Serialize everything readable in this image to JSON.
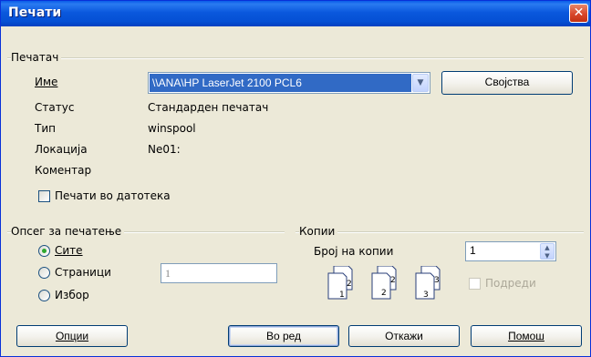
{
  "window": {
    "title": "Печати",
    "close": "✕"
  },
  "printer": {
    "group_title": "Печатач",
    "name_label": "Име",
    "name_value": "\\\\ANA\\HP LaserJet 2100 PCL6",
    "properties_button": "Својства",
    "status_label": "Статус",
    "status_value": "Стандарден печатач",
    "type_label": "Тип",
    "type_value": "winspool",
    "location_label": "Локација",
    "location_value": "Ne01:",
    "comment_label": "Коментар",
    "comment_value": "",
    "print_to_file_label": "Печати во датотека",
    "print_to_file_checked": false
  },
  "range": {
    "group_title": "Опсег за печатење",
    "all_label": "Сите",
    "pages_label": "Страници",
    "pages_value": "1",
    "selection_label": "Избор",
    "selected": "all"
  },
  "copies": {
    "group_title": "Копии",
    "count_label": "Број на копии",
    "count_value": "1",
    "collate_label": "Подреди",
    "collate_checked": false,
    "collate_enabled": false
  },
  "buttons": {
    "options": "Опции",
    "ok": "Во ред",
    "cancel": "Откажи",
    "help": "Помош"
  },
  "colors": {
    "titlebar": "#0a58dd",
    "selection": "#316ac5",
    "dialog_bg": "#ece9d8"
  }
}
